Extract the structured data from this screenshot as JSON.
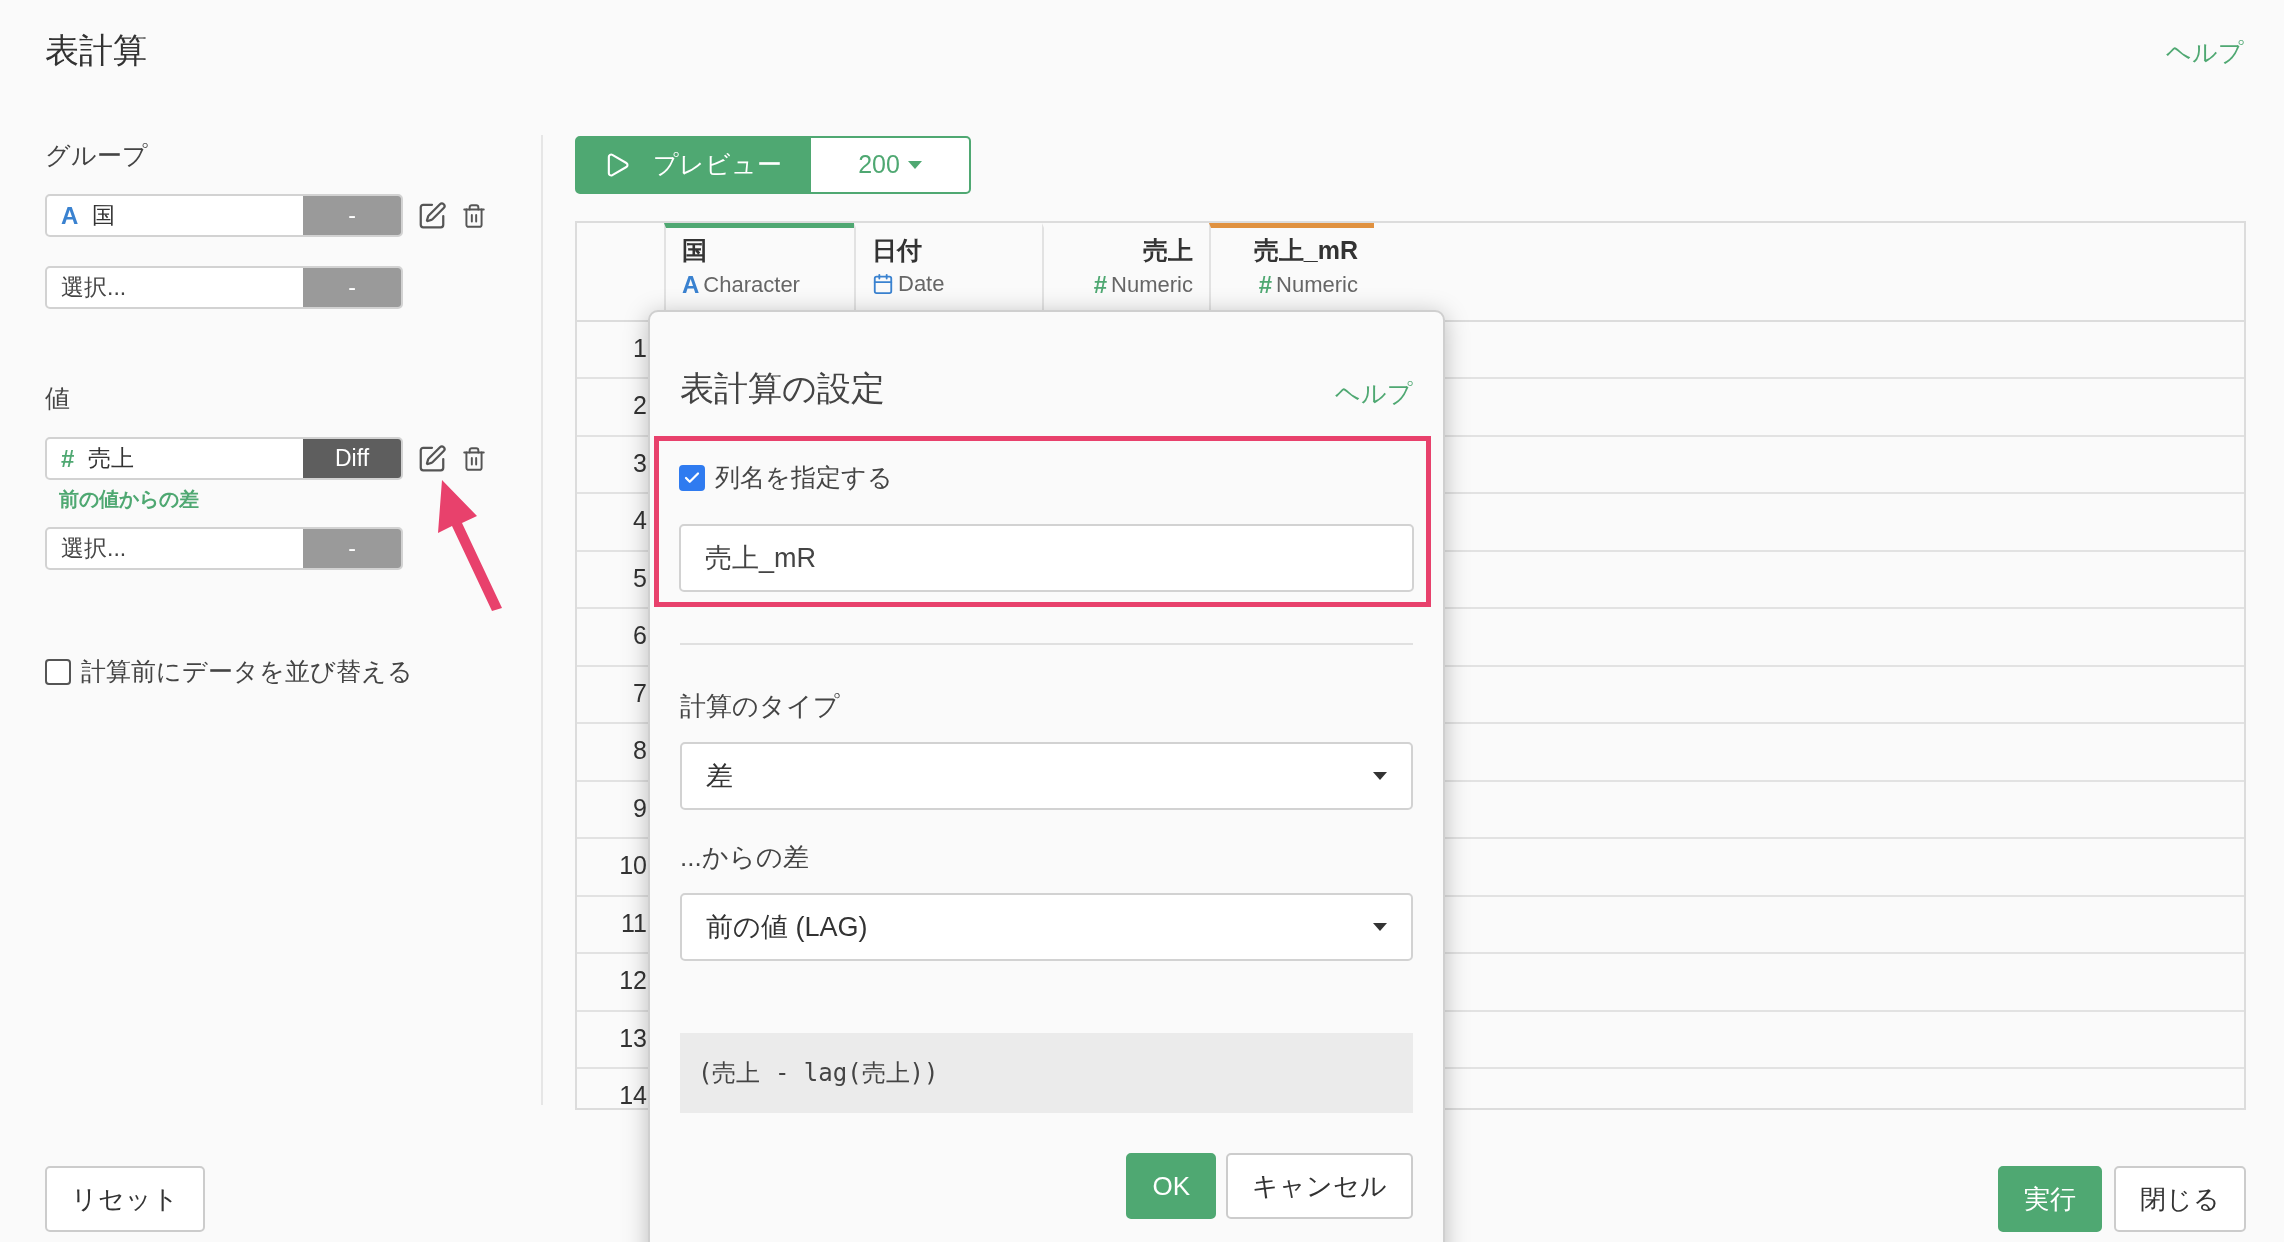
{
  "page": {
    "title": "表計算",
    "help": "ヘルプ"
  },
  "group": {
    "label": "グループ",
    "items": [
      {
        "kind": "character",
        "mark": "A",
        "name": "国",
        "button": "-",
        "configured": false
      },
      {
        "kind": "empty",
        "name": "選択...",
        "button": "-",
        "configured": false
      }
    ]
  },
  "values": {
    "label": "値",
    "items": [
      {
        "kind": "numeric",
        "mark": "#",
        "name": "売上",
        "button": "Diff",
        "configured": true,
        "note": "前の値からの差"
      },
      {
        "kind": "empty",
        "name": "選択...",
        "button": "-",
        "configured": false
      }
    ]
  },
  "sort_option": {
    "label": "計算前にデータを並び替える",
    "checked": false
  },
  "preview": {
    "label": "プレビュー",
    "count": "200"
  },
  "table": {
    "columns": [
      {
        "name": "国",
        "kind": "character",
        "mark": "A",
        "type": "Character",
        "color": "#4fa872"
      },
      {
        "name": "日付",
        "kind": "date",
        "type": "Date"
      },
      {
        "name": "売上",
        "kind": "numeric",
        "mark": "#",
        "type": "Numeric"
      },
      {
        "name": "売上_mR",
        "kind": "numeric",
        "mark": "#",
        "type": "Numeric",
        "color": "#e0913f"
      }
    ],
    "rows": [
      "1",
      "2",
      "3",
      "4",
      "5",
      "6",
      "7",
      "8",
      "9",
      "10",
      "11",
      "12",
      "13",
      "14"
    ]
  },
  "dialog": {
    "title": "表計算の設定",
    "help": "ヘルプ",
    "rename": {
      "label": "列名を指定する",
      "checked": true,
      "value": "売上_mR"
    },
    "calc_type": {
      "label": "計算のタイプ",
      "value": "差"
    },
    "diff_from": {
      "label": "...からの差",
      "value": "前の値 (LAG)"
    },
    "formula": "(売上 - lag(売上))",
    "ok": "OK",
    "cancel": "キャンセル"
  },
  "footer": {
    "reset": "リセット",
    "run": "実行",
    "close": "閉じる"
  }
}
